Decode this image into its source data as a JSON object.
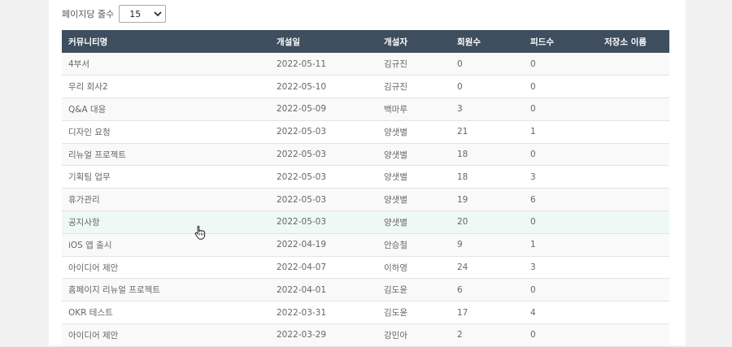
{
  "pagination": {
    "per_page_label": "페이지당 줄수",
    "per_page_value": "15"
  },
  "table": {
    "headers": {
      "name": "커뮤니티명",
      "created": "개설일",
      "owner": "개설자",
      "members": "회원수",
      "feeds": "피드수",
      "storage": "저장소 이름"
    },
    "rows": [
      {
        "name": "4부서",
        "created": "2022-05-11",
        "owner": "김규진",
        "members": "0",
        "feeds": "0",
        "storage": ""
      },
      {
        "name": "우리 회사2",
        "created": "2022-05-10",
        "owner": "김규진",
        "members": "0",
        "feeds": "0",
        "storage": ""
      },
      {
        "name": "Q&A 대응",
        "created": "2022-05-09",
        "owner": "백마루",
        "members": "3",
        "feeds": "0",
        "storage": ""
      },
      {
        "name": "디자인 요청",
        "created": "2022-05-03",
        "owner": "양샛별",
        "members": "21",
        "feeds": "1",
        "storage": ""
      },
      {
        "name": "리뉴얼 프로젝트",
        "created": "2022-05-03",
        "owner": "양샛별",
        "members": "18",
        "feeds": "0",
        "storage": ""
      },
      {
        "name": "기획팀 업무",
        "created": "2022-05-03",
        "owner": "양샛별",
        "members": "18",
        "feeds": "3",
        "storage": ""
      },
      {
        "name": "휴가관리",
        "created": "2022-05-03",
        "owner": "양샛별",
        "members": "19",
        "feeds": "6",
        "storage": ""
      },
      {
        "name": "공지사항",
        "created": "2022-05-03",
        "owner": "양샛별",
        "members": "20",
        "feeds": "0",
        "storage": ""
      },
      {
        "name": "iOS 앱 출시",
        "created": "2022-04-19",
        "owner": "안승철",
        "members": "9",
        "feeds": "1",
        "storage": ""
      },
      {
        "name": "아이디어 제안",
        "created": "2022-04-07",
        "owner": "이하영",
        "members": "24",
        "feeds": "3",
        "storage": ""
      },
      {
        "name": "홈페이지 리뉴얼 프로젝트",
        "created": "2022-04-01",
        "owner": "김도윤",
        "members": "6",
        "feeds": "0",
        "storage": ""
      },
      {
        "name": "OKR 테스트",
        "created": "2022-03-31",
        "owner": "김도윤",
        "members": "17",
        "feeds": "4",
        "storage": ""
      },
      {
        "name": "아이디어 제안",
        "created": "2022-03-29",
        "owner": "강민아",
        "members": "2",
        "feeds": "0",
        "storage": ""
      }
    ]
  },
  "colors": {
    "header_bg": "#3e4e5e",
    "hover_row": "#eef8f4",
    "page_bg": "#f1f1f2"
  }
}
